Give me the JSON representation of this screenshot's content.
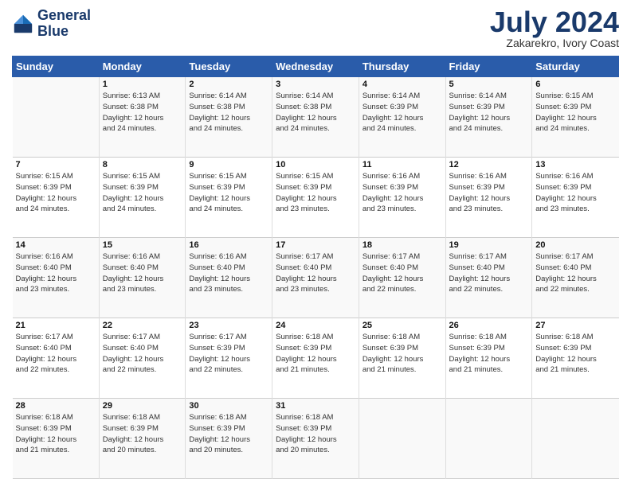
{
  "header": {
    "logo_line1": "General",
    "logo_line2": "Blue",
    "month": "July 2024",
    "location": "Zakarekro, Ivory Coast"
  },
  "weekdays": [
    "Sunday",
    "Monday",
    "Tuesday",
    "Wednesday",
    "Thursday",
    "Friday",
    "Saturday"
  ],
  "weeks": [
    [
      {
        "day": "",
        "info": ""
      },
      {
        "day": "1",
        "info": "Sunrise: 6:13 AM\nSunset: 6:38 PM\nDaylight: 12 hours\nand 24 minutes."
      },
      {
        "day": "2",
        "info": "Sunrise: 6:14 AM\nSunset: 6:38 PM\nDaylight: 12 hours\nand 24 minutes."
      },
      {
        "day": "3",
        "info": "Sunrise: 6:14 AM\nSunset: 6:38 PM\nDaylight: 12 hours\nand 24 minutes."
      },
      {
        "day": "4",
        "info": "Sunrise: 6:14 AM\nSunset: 6:39 PM\nDaylight: 12 hours\nand 24 minutes."
      },
      {
        "day": "5",
        "info": "Sunrise: 6:14 AM\nSunset: 6:39 PM\nDaylight: 12 hours\nand 24 minutes."
      },
      {
        "day": "6",
        "info": "Sunrise: 6:15 AM\nSunset: 6:39 PM\nDaylight: 12 hours\nand 24 minutes."
      }
    ],
    [
      {
        "day": "7",
        "info": "Sunrise: 6:15 AM\nSunset: 6:39 PM\nDaylight: 12 hours\nand 24 minutes."
      },
      {
        "day": "8",
        "info": "Sunrise: 6:15 AM\nSunset: 6:39 PM\nDaylight: 12 hours\nand 24 minutes."
      },
      {
        "day": "9",
        "info": "Sunrise: 6:15 AM\nSunset: 6:39 PM\nDaylight: 12 hours\nand 24 minutes."
      },
      {
        "day": "10",
        "info": "Sunrise: 6:15 AM\nSunset: 6:39 PM\nDaylight: 12 hours\nand 23 minutes."
      },
      {
        "day": "11",
        "info": "Sunrise: 6:16 AM\nSunset: 6:39 PM\nDaylight: 12 hours\nand 23 minutes."
      },
      {
        "day": "12",
        "info": "Sunrise: 6:16 AM\nSunset: 6:39 PM\nDaylight: 12 hours\nand 23 minutes."
      },
      {
        "day": "13",
        "info": "Sunrise: 6:16 AM\nSunset: 6:39 PM\nDaylight: 12 hours\nand 23 minutes."
      }
    ],
    [
      {
        "day": "14",
        "info": "Sunrise: 6:16 AM\nSunset: 6:40 PM\nDaylight: 12 hours\nand 23 minutes."
      },
      {
        "day": "15",
        "info": "Sunrise: 6:16 AM\nSunset: 6:40 PM\nDaylight: 12 hours\nand 23 minutes."
      },
      {
        "day": "16",
        "info": "Sunrise: 6:16 AM\nSunset: 6:40 PM\nDaylight: 12 hours\nand 23 minutes."
      },
      {
        "day": "17",
        "info": "Sunrise: 6:17 AM\nSunset: 6:40 PM\nDaylight: 12 hours\nand 23 minutes."
      },
      {
        "day": "18",
        "info": "Sunrise: 6:17 AM\nSunset: 6:40 PM\nDaylight: 12 hours\nand 22 minutes."
      },
      {
        "day": "19",
        "info": "Sunrise: 6:17 AM\nSunset: 6:40 PM\nDaylight: 12 hours\nand 22 minutes."
      },
      {
        "day": "20",
        "info": "Sunrise: 6:17 AM\nSunset: 6:40 PM\nDaylight: 12 hours\nand 22 minutes."
      }
    ],
    [
      {
        "day": "21",
        "info": "Sunrise: 6:17 AM\nSunset: 6:40 PM\nDaylight: 12 hours\nand 22 minutes."
      },
      {
        "day": "22",
        "info": "Sunrise: 6:17 AM\nSunset: 6:40 PM\nDaylight: 12 hours\nand 22 minutes."
      },
      {
        "day": "23",
        "info": "Sunrise: 6:17 AM\nSunset: 6:39 PM\nDaylight: 12 hours\nand 22 minutes."
      },
      {
        "day": "24",
        "info": "Sunrise: 6:18 AM\nSunset: 6:39 PM\nDaylight: 12 hours\nand 21 minutes."
      },
      {
        "day": "25",
        "info": "Sunrise: 6:18 AM\nSunset: 6:39 PM\nDaylight: 12 hours\nand 21 minutes."
      },
      {
        "day": "26",
        "info": "Sunrise: 6:18 AM\nSunset: 6:39 PM\nDaylight: 12 hours\nand 21 minutes."
      },
      {
        "day": "27",
        "info": "Sunrise: 6:18 AM\nSunset: 6:39 PM\nDaylight: 12 hours\nand 21 minutes."
      }
    ],
    [
      {
        "day": "28",
        "info": "Sunrise: 6:18 AM\nSunset: 6:39 PM\nDaylight: 12 hours\nand 21 minutes."
      },
      {
        "day": "29",
        "info": "Sunrise: 6:18 AM\nSunset: 6:39 PM\nDaylight: 12 hours\nand 20 minutes."
      },
      {
        "day": "30",
        "info": "Sunrise: 6:18 AM\nSunset: 6:39 PM\nDaylight: 12 hours\nand 20 minutes."
      },
      {
        "day": "31",
        "info": "Sunrise: 6:18 AM\nSunset: 6:39 PM\nDaylight: 12 hours\nand 20 minutes."
      },
      {
        "day": "",
        "info": ""
      },
      {
        "day": "",
        "info": ""
      },
      {
        "day": "",
        "info": ""
      }
    ]
  ]
}
